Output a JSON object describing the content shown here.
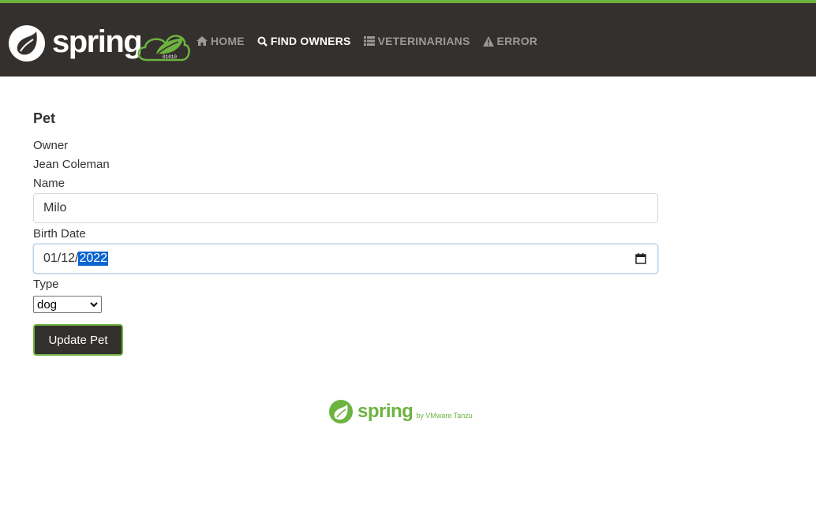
{
  "header": {
    "logo_text": "spring",
    "badge_text": "01010",
    "nav": [
      {
        "label": "HOME",
        "icon": "home-icon",
        "active": false
      },
      {
        "label": "FIND OWNERS",
        "icon": "search-icon",
        "active": true
      },
      {
        "label": "VETERINARIANS",
        "icon": "list-icon",
        "active": false
      },
      {
        "label": "ERROR",
        "icon": "warning-icon",
        "active": false
      }
    ]
  },
  "form": {
    "title": "Pet",
    "owner_label": "Owner",
    "owner_value": "Jean Coleman",
    "name_label": "Name",
    "name_value": "Milo",
    "birth_label": "Birth Date",
    "birth_prefix": "01/12/",
    "birth_year": "2022",
    "type_label": "Type",
    "type_value": "dog",
    "submit_label": "Update Pet"
  },
  "footer": {
    "word": "spring",
    "byline": "by VMware Tanzu"
  },
  "colors": {
    "brand_green": "#6db33f",
    "header_bg": "#34302d",
    "selection": "#0a64d2"
  }
}
